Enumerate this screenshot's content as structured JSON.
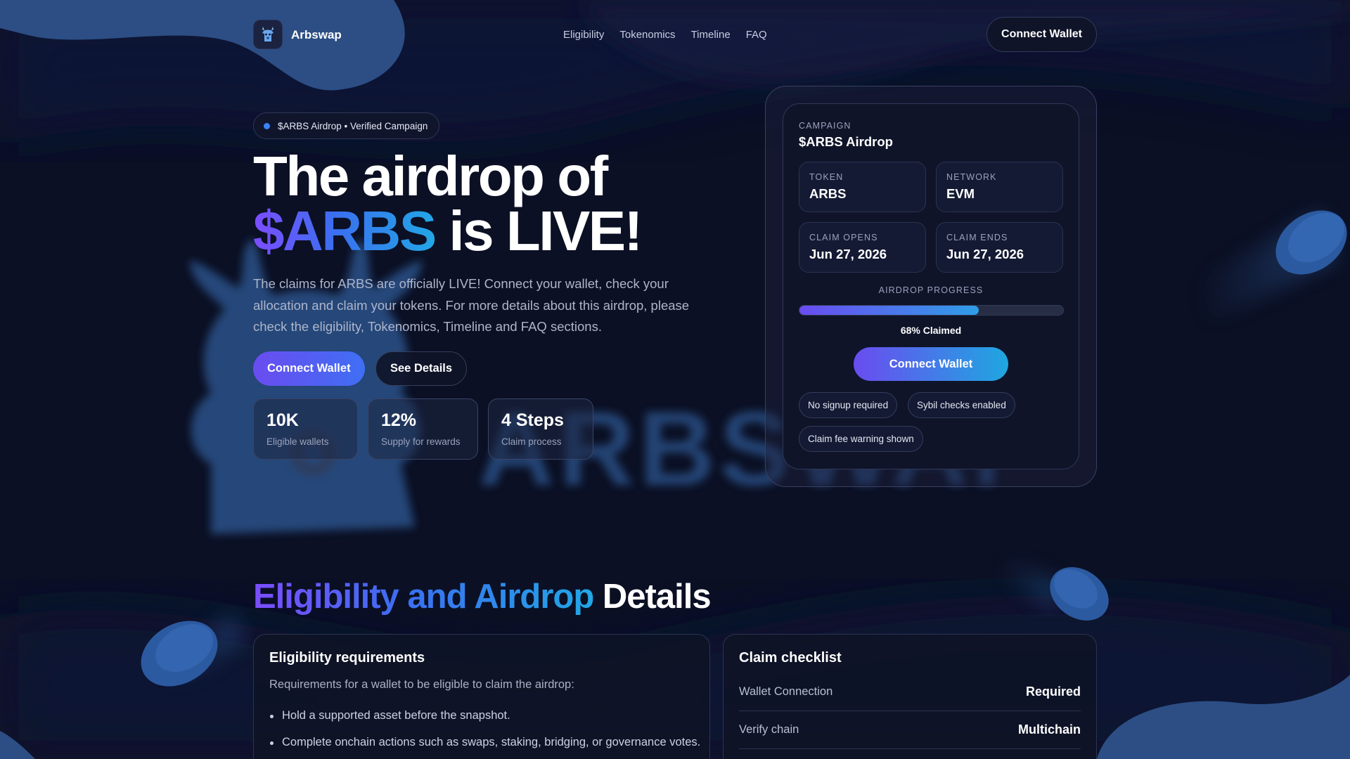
{
  "nav": {
    "brand": "Arbswap",
    "links": [
      "Eligibility",
      "Tokenomics",
      "Timeline",
      "FAQ"
    ],
    "cta": "Connect Wallet"
  },
  "hero": {
    "pill": "$ARBS Airdrop • Verified Campaign",
    "title_line1": "The airdrop of",
    "title_highlight": "$ARBS",
    "title_rest": " is LIVE!",
    "description": "The claims for ARBS are officially LIVE! Connect your wallet, check your allocation and claim your tokens. For more details about this airdrop, please check the eligibility, Tokenomics, Timeline and FAQ sections.",
    "primary_button": "Connect Wallet",
    "secondary_button": "See Details",
    "stats": [
      {
        "value": "10K",
        "label": "Eligible wallets"
      },
      {
        "value": "12%",
        "label": "Supply for rewards"
      },
      {
        "value": "4 Steps",
        "label": "Claim process"
      }
    ]
  },
  "campaign": {
    "label": "CAMPAIGN",
    "name": "$ARBS Airdrop",
    "token_label": "TOKEN",
    "token": "ARBS",
    "network_label": "NETWORK",
    "network": "EVM",
    "opens_label": "CLAIM OPENS",
    "opens": "Jun 27, 2026",
    "ends_label": "CLAIM ENDS",
    "ends": "Jun 27, 2026",
    "progress_label": "AIRDROP PROGRESS",
    "progress_percent": 68,
    "progress_text": "68% Claimed",
    "cta": "Connect Wallet",
    "tags": [
      "No signup required",
      "Sybil checks enabled",
      "Claim fee warning shown"
    ]
  },
  "section": {
    "title_gradient": "Eligibility and Airdrop",
    "title_rest": " Details",
    "eligibility": {
      "title": "Eligibility requirements",
      "subtitle": "Requirements for a wallet to be eligible to claim the airdrop:",
      "items": [
        "Hold a supported asset before the snapshot.",
        "Complete onchain actions such as swaps, staking, bridging, or governance votes."
      ]
    },
    "checklist": {
      "title": "Claim checklist",
      "rows": [
        {
          "name": "Wallet Connection",
          "value": "Required"
        },
        {
          "name": "Verify chain",
          "value": "Multichain"
        }
      ]
    }
  },
  "background": {
    "watermark": "ARBSWAP"
  },
  "colors": {
    "background": "#0b1024",
    "accent_purple": "#6a4cf0",
    "accent_blue": "#2f9ee8",
    "blob_blue": "#2a4f86"
  }
}
